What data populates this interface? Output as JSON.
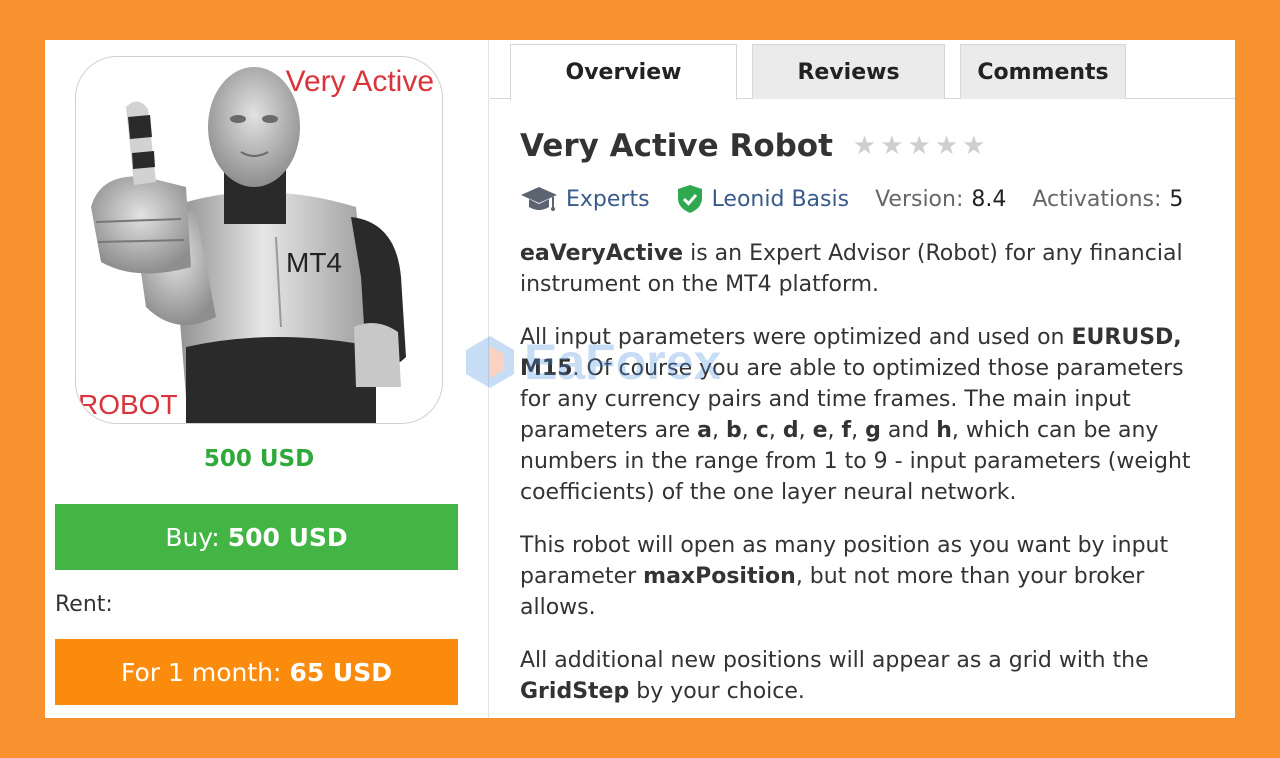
{
  "image": {
    "text_top": "Very Active",
    "text_mt4": "MT4",
    "text_robot": "ROBOT"
  },
  "price": "500 USD",
  "buy_button": {
    "label": "Buy:",
    "amount": "500 USD"
  },
  "rent_label": "Rent:",
  "rent_button": {
    "label": "For 1 month:",
    "amount": "65 USD"
  },
  "tabs": [
    {
      "label": "Overview",
      "active": true
    },
    {
      "label": "Reviews",
      "active": false
    },
    {
      "label": "Comments",
      "active": false
    }
  ],
  "title": "Very Active Robot",
  "rating": {
    "value": 0,
    "max": 5
  },
  "meta": {
    "category": "Experts",
    "author": "Leonid Basis",
    "version_label": "Version:",
    "version_value": "8.4",
    "activations_label": "Activations:",
    "activations_value": "5"
  },
  "description": {
    "p1_bold": "eaVeryActive",
    "p1_text": " is an Expert Advisor (Robot) for any financial instrument on the MT4 platform.",
    "p2_a": "All input parameters were optimized and used on ",
    "p2_b": "EURUSD, M15",
    "p2_c": ". Of course you are able to optimized those parameters for any currency pairs and time frames. The main input parameters are ",
    "p2_params": [
      "a",
      "b",
      "c",
      "d",
      "e",
      "f",
      "g"
    ],
    "p2_and": " and ",
    "p2_last": "h",
    "p2_d": ", which can be any numbers in the range from 1 to 9 - input parameters (weight coefficients) of the one layer neural network.",
    "p3_a": "This robot will open as many position as you want by input parameter ",
    "p3_b": "maxPosition",
    "p3_c": ", but not more than your broker allows.",
    "p4_a": "All additional new positions will appear as a grid with the ",
    "p4_b": "GridStep",
    "p4_c": " by your choice."
  },
  "watermark": "EaForex",
  "colors": {
    "background": "#f7922e",
    "price_green": "#2ea93a",
    "buy_green": "#43b545",
    "rent_orange": "#fb8b0c",
    "link_blue": "#3a5a8c",
    "image_red": "#d9343c"
  }
}
